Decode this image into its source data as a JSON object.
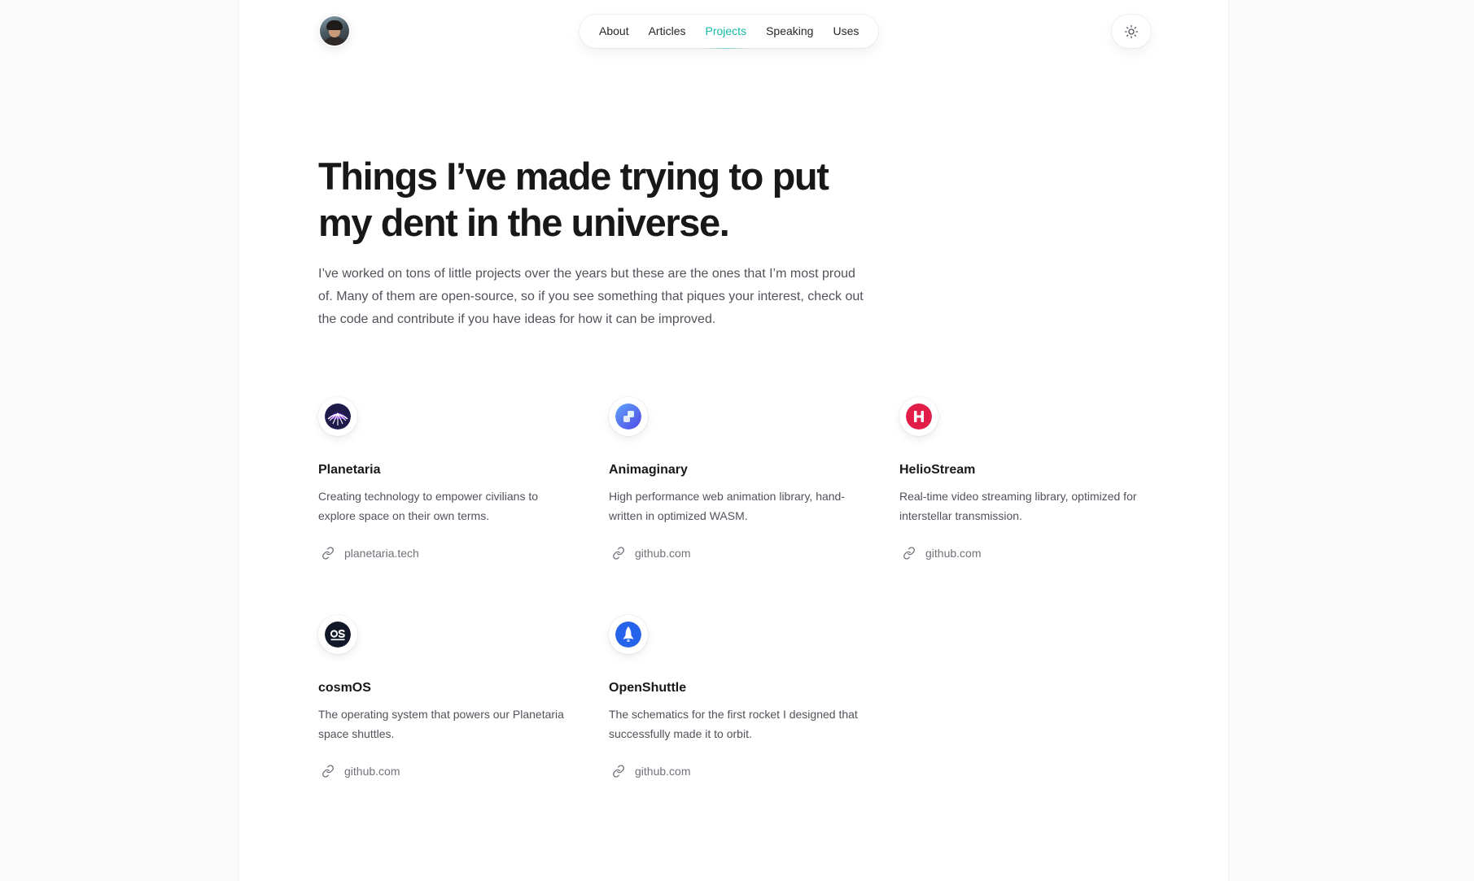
{
  "nav": {
    "items": [
      {
        "label": "About",
        "active": false
      },
      {
        "label": "Articles",
        "active": false
      },
      {
        "label": "Projects",
        "active": true
      },
      {
        "label": "Speaking",
        "active": false
      },
      {
        "label": "Uses",
        "active": false
      }
    ]
  },
  "hero": {
    "title": "Things I’ve made trying to put my dent in the universe.",
    "intro": "I’ve worked on tons of little projects over the years but these are the ones that I’m most proud of. Many of them are open-source, so if you see something that piques your interest, check out the code and contribute if you have ideas for how it can be improved."
  },
  "projects": [
    {
      "name": "Planetaria",
      "description": "Creating technology to empower civilians to explore space on their own terms.",
      "link": "planetaria.tech",
      "icon": "planetaria-logo-icon"
    },
    {
      "name": "Animaginary",
      "description": "High performance web animation library, hand-written in optimized WASM.",
      "link": "github.com",
      "icon": "animaginary-logo-icon"
    },
    {
      "name": "HelioStream",
      "description": "Real-time video streaming library, optimized for interstellar transmission.",
      "link": "github.com",
      "icon": "heliostream-logo-icon"
    },
    {
      "name": "cosmOS",
      "description": "The operating system that powers our Planetaria space shuttles.",
      "link": "github.com",
      "icon": "cosmos-logo-icon"
    },
    {
      "name": "OpenShuttle",
      "description": "The schematics for the first rocket I designed that successfully made it to orbit.",
      "link": "github.com",
      "icon": "openshuttle-logo-icon"
    }
  ],
  "colors": {
    "accent": "#14b8a6",
    "heliostream": "#e11d48",
    "openshuttle": "#2563eb"
  }
}
